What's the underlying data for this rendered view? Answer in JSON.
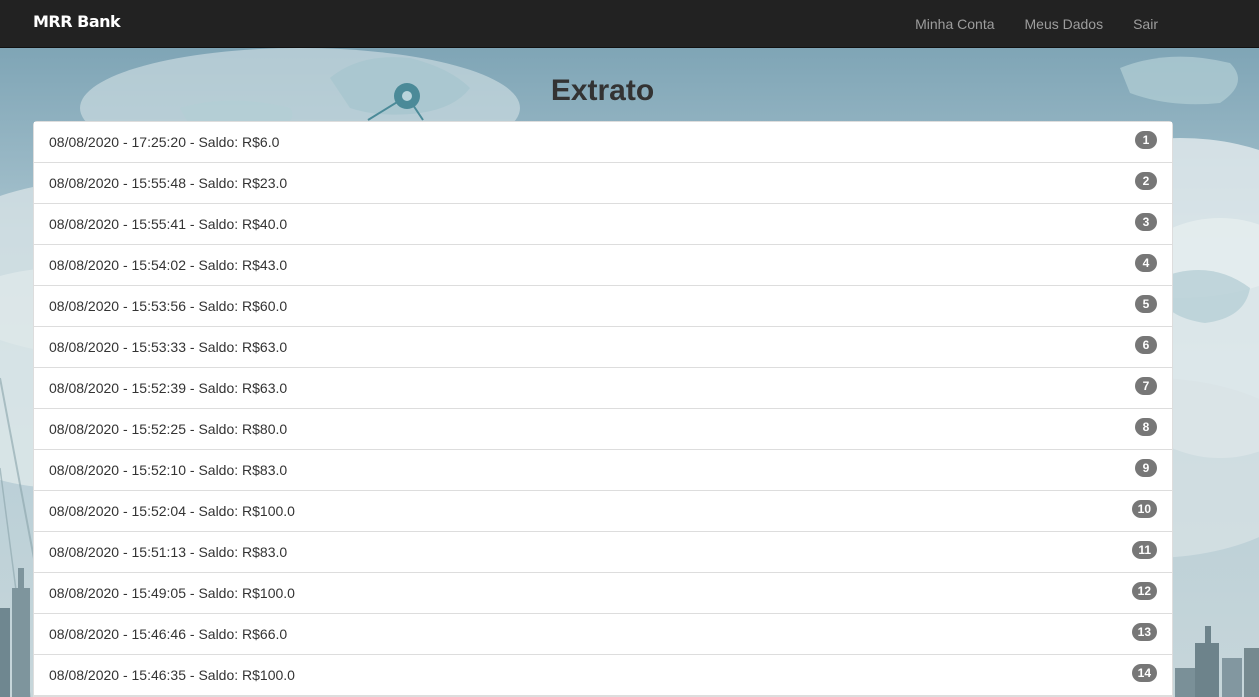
{
  "navbar": {
    "brand": "MRR Bank",
    "links": [
      "Minha Conta",
      "Meus Dados",
      "Sair"
    ]
  },
  "page": {
    "title": "Extrato"
  },
  "statement": [
    {
      "text": "08/08/2020 - 17:25:20 - Saldo: R$6.0",
      "badge": "1"
    },
    {
      "text": "08/08/2020 - 15:55:48 - Saldo: R$23.0",
      "badge": "2"
    },
    {
      "text": "08/08/2020 - 15:55:41 - Saldo: R$40.0",
      "badge": "3"
    },
    {
      "text": "08/08/2020 - 15:54:02 - Saldo: R$43.0",
      "badge": "4"
    },
    {
      "text": "08/08/2020 - 15:53:56 - Saldo: R$60.0",
      "badge": "5"
    },
    {
      "text": "08/08/2020 - 15:53:33 - Saldo: R$63.0",
      "badge": "6"
    },
    {
      "text": "08/08/2020 - 15:52:39 - Saldo: R$63.0",
      "badge": "7"
    },
    {
      "text": "08/08/2020 - 15:52:25 - Saldo: R$80.0",
      "badge": "8"
    },
    {
      "text": "08/08/2020 - 15:52:10 - Saldo: R$83.0",
      "badge": "9"
    },
    {
      "text": "08/08/2020 - 15:52:04 - Saldo: R$100.0",
      "badge": "10"
    },
    {
      "text": "08/08/2020 - 15:51:13 - Saldo: R$83.0",
      "badge": "11"
    },
    {
      "text": "08/08/2020 - 15:49:05 - Saldo: R$100.0",
      "badge": "12"
    },
    {
      "text": "08/08/2020 - 15:46:46 - Saldo: R$66.0",
      "badge": "13"
    },
    {
      "text": "08/08/2020 - 15:46:35 - Saldo: R$100.0",
      "badge": "14"
    }
  ],
  "colors": {
    "navbar": "#222222",
    "nav_link": "#9d9d9d",
    "badge": "#777777"
  }
}
